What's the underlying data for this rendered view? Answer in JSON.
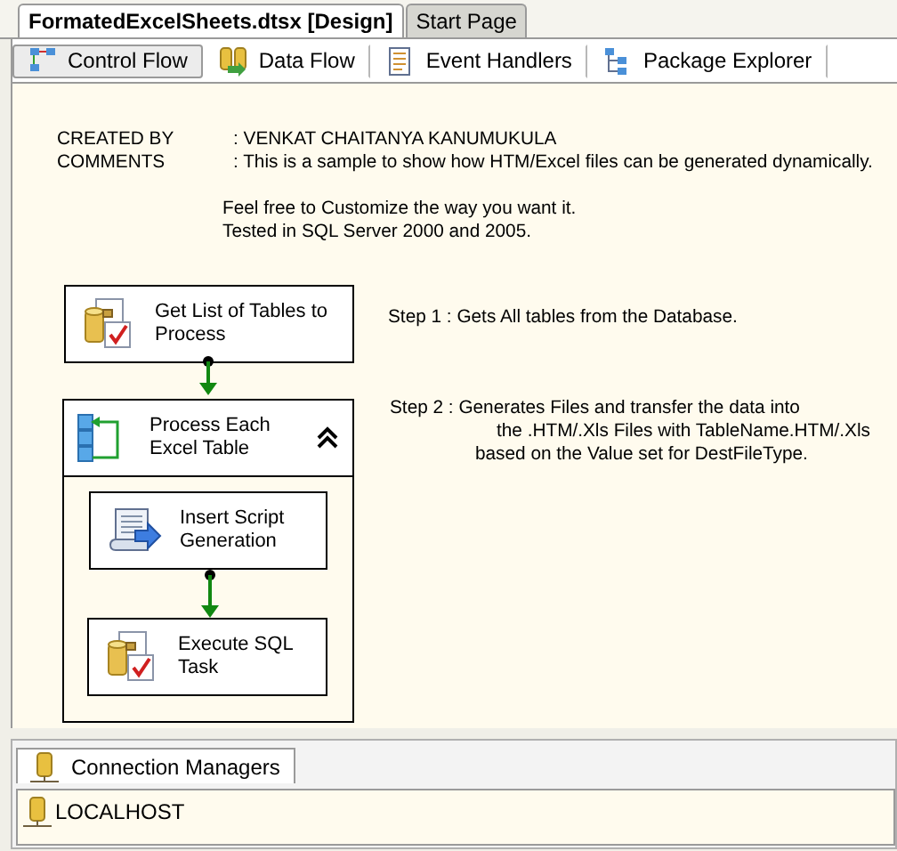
{
  "document_tabs": [
    {
      "label": "FormatedExcelSheets.dtsx [Design]",
      "selected": true
    },
    {
      "label": "Start Page",
      "selected": false
    }
  ],
  "designer_tabs": [
    {
      "label": "Control Flow",
      "kind": "control",
      "selected": true
    },
    {
      "label": "Data Flow",
      "kind": "data",
      "selected": false
    },
    {
      "label": "Event Handlers",
      "kind": "events",
      "selected": false
    },
    {
      "label": "Package Explorer",
      "kind": "explorer",
      "selected": false
    }
  ],
  "header_fields": [
    {
      "label": "CREATED BY",
      "value": ": VENKAT CHAITANYA KANUMUKULA"
    },
    {
      "label": "COMMENTS",
      "value": ": This is a sample to show how HTM/Excel files can be generated dynamically."
    }
  ],
  "notes": [
    "Feel free to Customize the way you want it.",
    "Tested in SQL Server 2000 and 2005."
  ],
  "steps": [
    {
      "lines": [
        "Step 1 : Gets All tables from the Database."
      ]
    },
    {
      "lines": [
        "Step 2 : Generates Files and transfer the data into",
        "the .HTM/.Xls Files with TableName.HTM/.Xls",
        "based on the Value set for DestFileType."
      ]
    }
  ],
  "tasks": [
    {
      "label": "Get List of Tables to Process",
      "kind": "sql"
    }
  ],
  "container": {
    "label": "Process Each Excel Table",
    "expanded": true,
    "children": [
      {
        "label": "Insert Script Generation",
        "kind": "script"
      },
      {
        "label": "Execute SQL Task",
        "kind": "sql"
      }
    ]
  },
  "connection_tab": {
    "label": "Connection Managers",
    "selected": true
  },
  "connections": [
    "LOCALHOST"
  ]
}
